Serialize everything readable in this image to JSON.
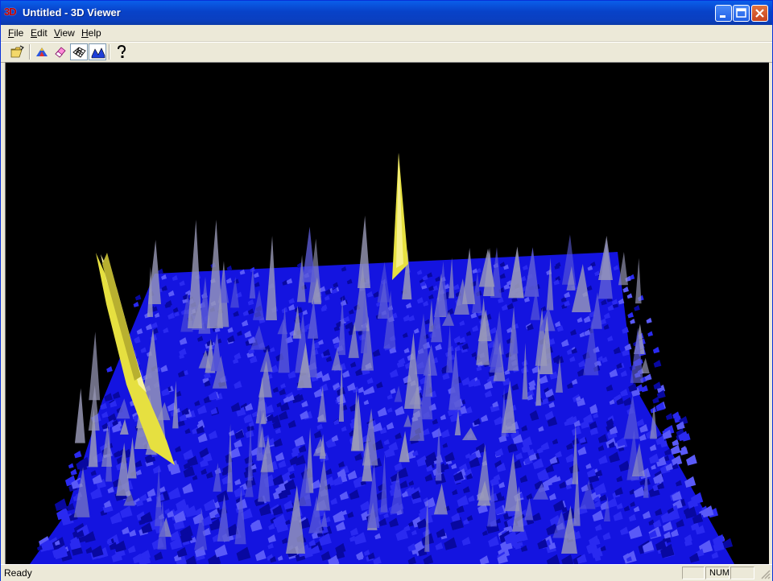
{
  "window": {
    "icon_text": "3D",
    "title": "Untitled - 3D Viewer"
  },
  "menu": {
    "items": [
      {
        "label": "File",
        "accel": "F",
        "rest": "ile"
      },
      {
        "label": "Edit",
        "accel": "E",
        "rest": "dit"
      },
      {
        "label": "View",
        "accel": "V",
        "rest": "iew"
      },
      {
        "label": "Help",
        "accel": "H",
        "rest": "elp"
      }
    ]
  },
  "toolbar": {
    "buttons": [
      "open-icon",
      "color-shading-icon",
      "erase-icon",
      "wireframe-icon",
      "surface-icon",
      "help-icon"
    ]
  },
  "colors": {
    "surface": "#1414e0",
    "peak_highlight": "#e6e040",
    "peak_grey": "#9a9ab8",
    "background": "#000000"
  },
  "status": {
    "text": "Ready",
    "num": "NUM"
  }
}
